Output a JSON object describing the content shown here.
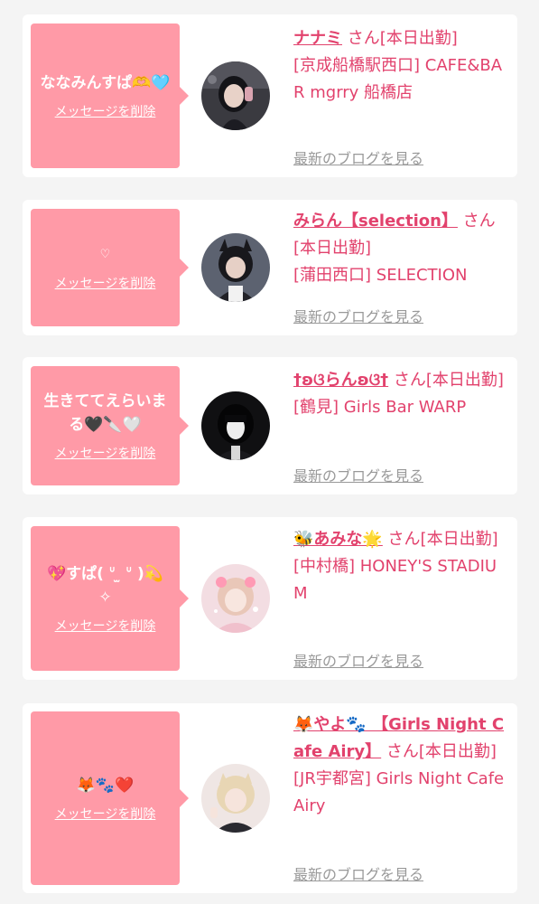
{
  "common": {
    "delete_label": "メッセージを削除",
    "blog_label": "最新のブログを見る"
  },
  "cards": [
    {
      "message": "ななみんすぱ🫶🩵",
      "name": "ナナミ",
      "suffix": " さん[本日出勤]",
      "shop": "[京成船橋駅西口] CAFE&BAR mgrry 船橋店"
    },
    {
      "message": "♡",
      "name": "みらん【selection】",
      "suffix": " さん[本日出勤]",
      "shop": "[蒲田西口] SELECTION"
    },
    {
      "message": "生きててえらいまる🖤🔪🤍",
      "name": "†ʚଓらんʚଓ†",
      "suffix": " さん[本日出勤]",
      "shop": "[鶴見] Girls Bar WARP"
    },
    {
      "message": "💖すぱ( ᐡ ̫ ᐡ )💫 ✧",
      "name": "🐝あみな🌟",
      "suffix": " さん[本日出勤]",
      "shop": "[中村橋] HONEY'S STADIUM"
    },
    {
      "message": "🦊🐾❤️",
      "name": "🦊やよ🐾 【Girls Night Cafe Airy】",
      "suffix": " さん[本日出勤]",
      "shop": "[JR宇都宮] Girls Night Cafe Airy"
    }
  ]
}
